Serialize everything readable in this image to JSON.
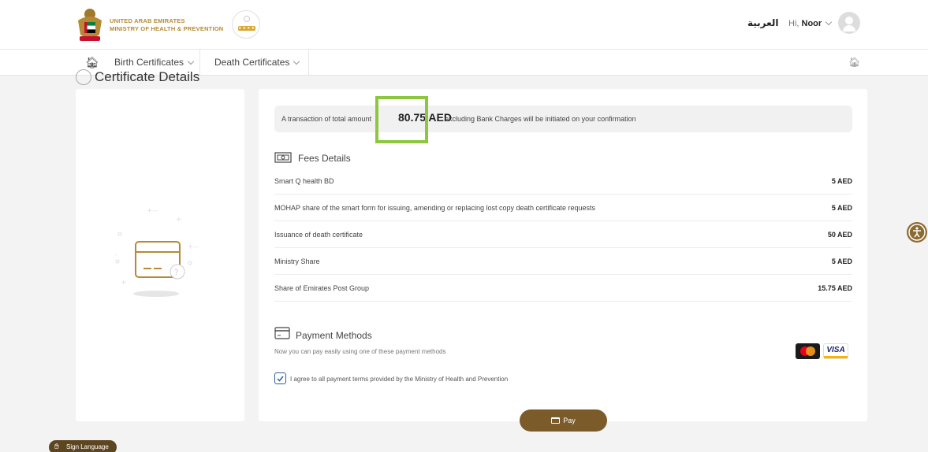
{
  "header": {
    "brand_line1": "UNITED ARAB EMIRATES",
    "brand_line2": "MINISTRY OF HEALTH & PREVENTION",
    "language_label": "العربية",
    "greeting": "Hi,",
    "user_name": "Noor"
  },
  "nav": {
    "items": [
      {
        "label": "Birth Certificates"
      },
      {
        "label": "Death Certificates"
      }
    ]
  },
  "page": {
    "title": "Certificate Details"
  },
  "notice": {
    "prefix": "A transaction of total amount",
    "amount": "80.75 AED",
    "suffix": "excluding Bank Charges will be initiated on your confirmation"
  },
  "fees": {
    "title": "Fees Details",
    "rows": [
      {
        "label": "Smart Q health BD",
        "value": "5 AED"
      },
      {
        "label": "MOHAP share of the smart form for issuing, amending or replacing lost copy death certificate requests",
        "value": "5 AED"
      },
      {
        "label": "Issuance of death certificate",
        "value": "50 AED"
      },
      {
        "label": "Ministry Share",
        "value": "5 AED"
      },
      {
        "label": "Share of Emirates Post Group",
        "value": "15.75 AED"
      }
    ]
  },
  "payment": {
    "title": "Payment Methods",
    "subtitle": "Now you can pay easily using one of these payment methods",
    "visa_label": "VISA",
    "agree_text": "I agree to all payment terms provided by the Ministry of Health and Prevention",
    "agree_checked": true,
    "pay_label": "Pay"
  },
  "footer": {
    "sign_language": "Sign Language"
  },
  "colors": {
    "accent_gold": "#b68a35",
    "button_brown": "#7b5b2a",
    "highlight_green": "#8dc63f"
  }
}
